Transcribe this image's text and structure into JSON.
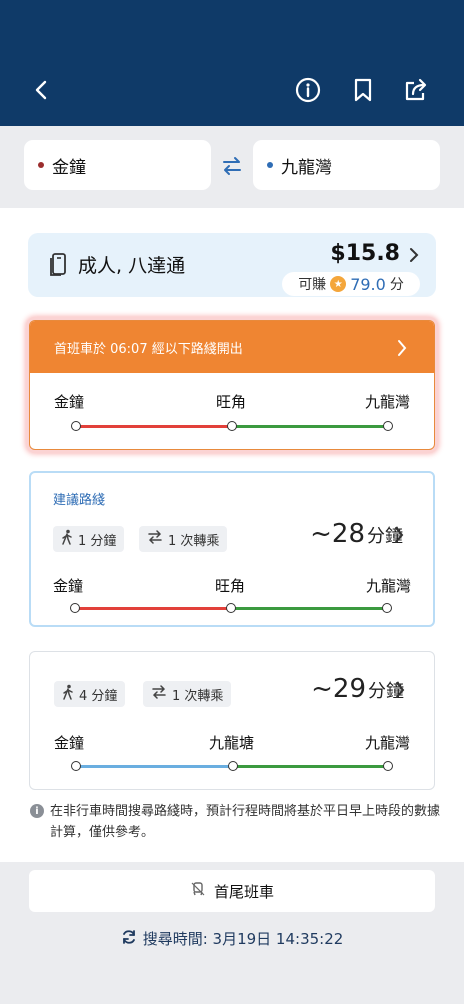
{
  "header": {
    "back_icon": "back-icon",
    "icons": [
      "info-icon",
      "bookmark-icon",
      "share-icon"
    ]
  },
  "stations": {
    "origin": "金鐘",
    "origin_color": "#9b2d2d",
    "destination": "九龍灣",
    "destination_color": "#2f6db5"
  },
  "fare": {
    "passenger_type": "成人, 八達通",
    "price": "$15.8",
    "earn_label": "可賺",
    "earn_points": "79.0",
    "earn_unit": "分"
  },
  "first_train": {
    "banner": "首班車於 06:07 經以下路綫開出",
    "stations": [
      "金鐘",
      "旺角",
      "九龍灣"
    ],
    "line_colors": [
      "#e2403a",
      "#3b9a3f"
    ]
  },
  "recommended": {
    "title": "建議路綫",
    "walk": "1 分鐘",
    "transfer": "1 次轉乘",
    "duration": "~28",
    "duration_unit": "分鐘",
    "stations": [
      "金鐘",
      "旺角",
      "九龍灣"
    ],
    "line_colors": [
      "#e2403a",
      "#3b9a3f"
    ]
  },
  "alternative": {
    "walk": "4 分鐘",
    "transfer": "1 次轉乘",
    "duration": "~29",
    "duration_unit": "分鐘",
    "stations": [
      "金鐘",
      "九龍塘",
      "九龍灣"
    ],
    "line_colors": [
      "#6aaee0",
      "#3b9a3f"
    ]
  },
  "note": "在非行車時間搜尋路綫時，預計行程時間將基於平日早上時段的數據計算，僅供參考。",
  "footer": {
    "schedule_button": "首尾班車",
    "search_time": "搜尋時間: 3月19日 14:35:22"
  }
}
